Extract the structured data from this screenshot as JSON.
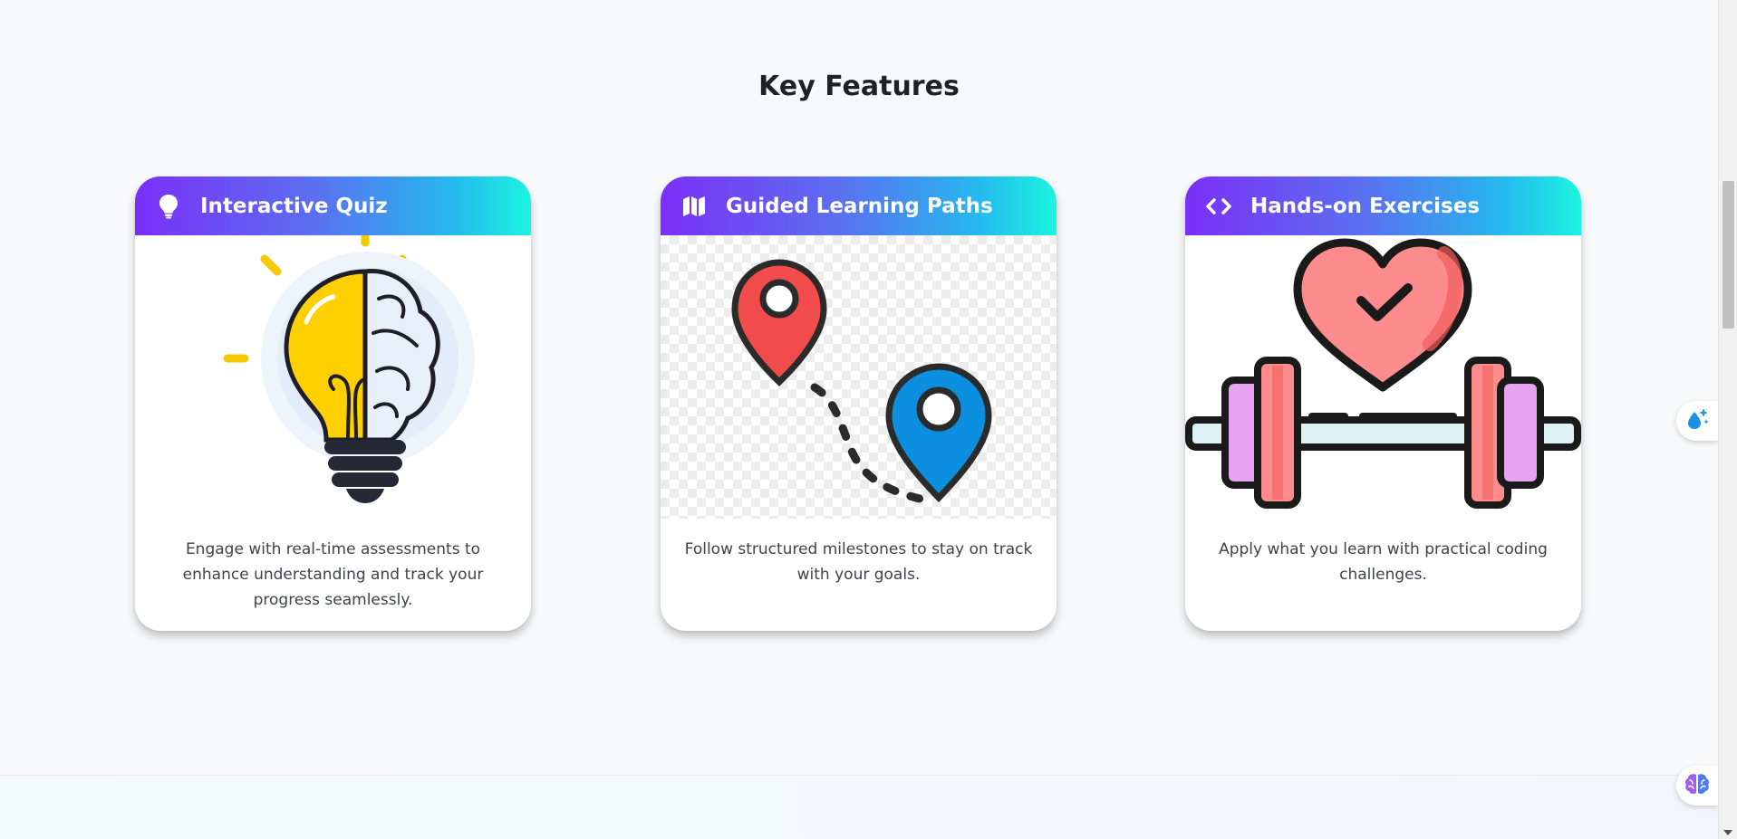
{
  "section": {
    "title": "Key Features"
  },
  "features": [
    {
      "title": "Interactive Quiz",
      "icon": "lightbulb-icon",
      "image": "lightbulb-brain-illustration",
      "description": "Engage with real-time assessments to enhance understanding and track your progress seamlessly."
    },
    {
      "title": "Guided Learning Paths",
      "icon": "map-icon",
      "image": "map-pins-path-illustration",
      "description": "Follow structured milestones to stay on track with your goals."
    },
    {
      "title": "Hands-on Exercises",
      "icon": "code-icon",
      "image": "heart-dumbbell-illustration",
      "description": "Apply what you learn with practical coding challenges."
    }
  ],
  "floating_buttons": [
    {
      "icon": "water-sparkle-icon"
    },
    {
      "icon": "brain-icon"
    }
  ],
  "colors": {
    "gradient_start": "#7b2ff7",
    "gradient_end": "#1cf4e0",
    "background": "#f8f9fb"
  }
}
